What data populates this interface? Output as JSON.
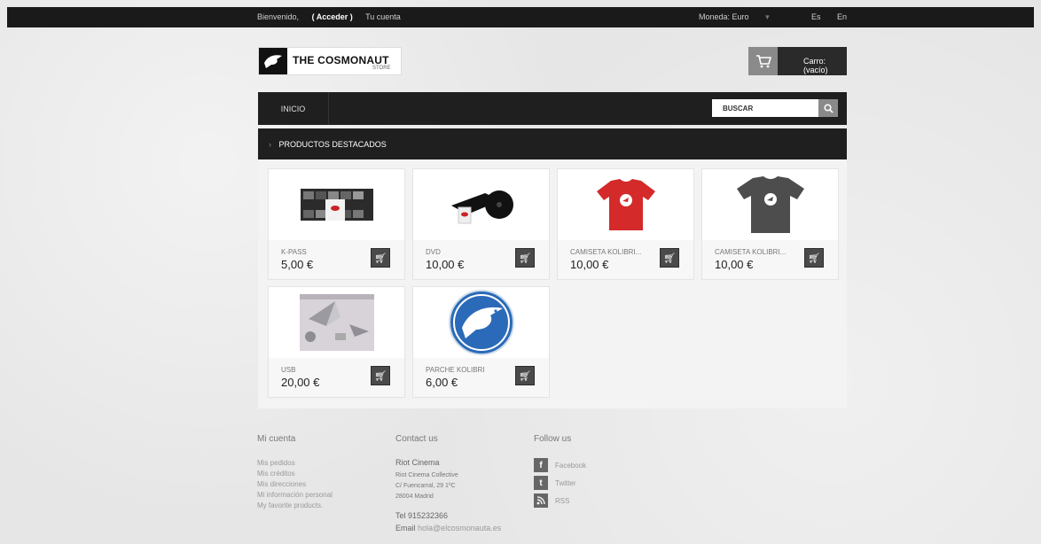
{
  "topbar": {
    "welcome": "Bienvenido,",
    "login": "( Acceder )",
    "account": "Tu cuenta",
    "currency_label": "Moneda: Euro",
    "langs": [
      "Es",
      "En"
    ]
  },
  "brand": {
    "name": "THE COSMONAUT",
    "sub": "STORE"
  },
  "cart": {
    "label": "Carro: (vacío)"
  },
  "nav": {
    "home": "INICIO",
    "search_placeholder": "BUSCAR"
  },
  "section": {
    "title": "PRODUCTOS DESTACADOS"
  },
  "products": [
    {
      "name": "K-PASS",
      "price": "5,00 €"
    },
    {
      "name": "DVD",
      "price": "10,00 €"
    },
    {
      "name": "CAMISETA KOLIBRI...",
      "price": "10,00 €"
    },
    {
      "name": "CAMISETA KOLIBRI...",
      "price": "10,00 €"
    },
    {
      "name": "USB",
      "price": "20,00 €"
    },
    {
      "name": "PARCHE KOLIBRI",
      "price": "6,00 €"
    }
  ],
  "footer": {
    "account": {
      "title": "Mi cuenta",
      "links": [
        "Mis pedidos",
        "Mis créditos",
        "Mis direcciones",
        "Mi información personal",
        "My favorite products."
      ]
    },
    "contact": {
      "title": "Contact us",
      "company": "Riot Cinema",
      "lines": [
        "Riot Cinema Collective",
        "C/ Fuencarral, 29 1ºC",
        "28004 Madrid"
      ],
      "tel": "Tel 915232366",
      "email_label": "Email",
      "email": "hola@elcosmonauta.es"
    },
    "follow": {
      "title": "Follow us",
      "items": [
        "Facebook",
        "Twitter",
        "RSS"
      ]
    }
  },
  "colors": {
    "dark": "#1f1f1f",
    "accent_gray": "#8a8a8a",
    "tshirt_red": "#d42a2a",
    "tshirt_gray": "#4d4d4d",
    "patch_blue": "#2a6ab8"
  }
}
